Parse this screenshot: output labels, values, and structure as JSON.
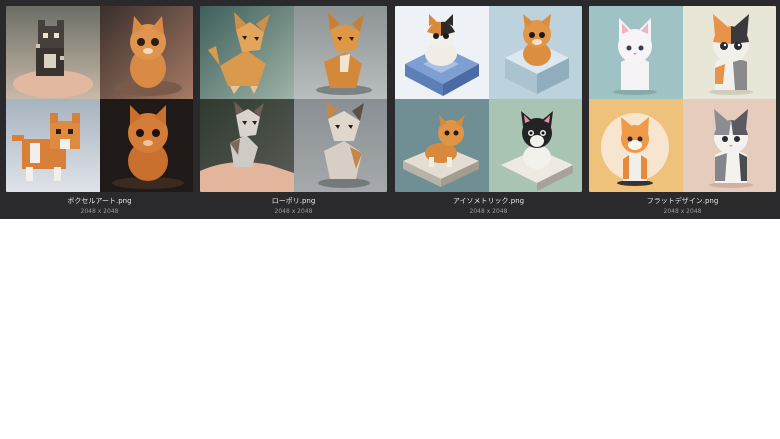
{
  "gallery": {
    "items": [
      {
        "file_name": "ボクセルアート.png",
        "dimensions": "2048 x 2048",
        "image_subjects": [
          "voxel kitten held in hand",
          "orange kitten",
          "orange voxel kitten",
          "fluffy orange kitten"
        ]
      },
      {
        "file_name": "ローポリ.png",
        "dimensions": "2048 x 2048",
        "image_subjects": [
          "low-poly orange kitten",
          "low-poly orange kitten",
          "low-poly calico kitten on hand",
          "low-poly calico kitten"
        ]
      },
      {
        "file_name": "アイソメトリック.png",
        "dimensions": "2048 x 2048",
        "image_subjects": [
          "isometric calico kitten on block",
          "isometric orange kitten on cube",
          "isometric orange kitten on tile",
          "isometric tuxedo kitten on tile"
        ]
      },
      {
        "file_name": "フラットデザイン.png",
        "dimensions": "2048 x 2048",
        "image_subjects": [
          "flat white kitten",
          "flat calico kitten",
          "flat orange kitten",
          "flat gray kitten"
        ]
      }
    ]
  },
  "colors": {
    "panel_background": "#2a2a2c",
    "filename_text": "#e8e8e8",
    "dimension_text": "#9a9a9a",
    "page_background": "#ffffff"
  }
}
